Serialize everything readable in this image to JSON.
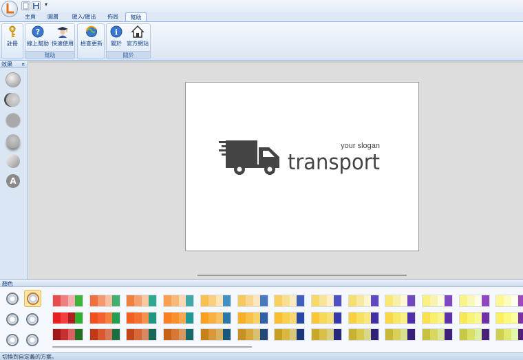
{
  "tabs": [
    "主頁",
    "圖層",
    "匯入/匯出",
    "佈局",
    "幫助"
  ],
  "active_tab": "幫助",
  "ribbon": {
    "groups": [
      {
        "label": "",
        "buttons": [
          {
            "label": "註冊",
            "icon": "key-icon"
          }
        ]
      },
      {
        "label": "幫助",
        "buttons": [
          {
            "label": "線上幫助",
            "icon": "help-icon"
          },
          {
            "label": "快速使用",
            "icon": "graduate-icon"
          }
        ]
      },
      {
        "label": "",
        "buttons": [
          {
            "label": "檢查更新",
            "icon": "update-globe-icon"
          }
        ]
      },
      {
        "label": "關於",
        "buttons": [
          {
            "label": "關於",
            "icon": "info-icon"
          },
          {
            "label": "官方網站",
            "icon": "home-icon"
          }
        ]
      }
    ]
  },
  "effects_panel": {
    "title": "效果",
    "items": [
      "effect-plain",
      "effect-shadow-left",
      "effect-flat",
      "effect-drop-shadow",
      "effect-gradient",
      "effect-text-a"
    ],
    "text_glyph": "A"
  },
  "logo": {
    "slogan": "your slogan",
    "name": "transport",
    "color": "#444444"
  },
  "colors_panel": {
    "title": "顏色",
    "palettes": [
      [
        [
          "#e84c4c",
          "#f08080",
          "#f4b0b0",
          "#3cb43c"
        ],
        [
          "#e82020",
          "#f04040",
          "#b02020",
          "#30b030"
        ],
        [
          "#a01818",
          "#c83030",
          "#d86060",
          "#207020"
        ]
      ],
      [
        [
          "#f07040",
          "#f49870",
          "#f8c0a0",
          "#40b070"
        ],
        [
          "#f05020",
          "#f46030",
          "#f48040",
          "#20a050"
        ],
        [
          "#c03818",
          "#d85830",
          "#d87858",
          "#187040"
        ]
      ],
      [
        [
          "#f08040",
          "#f4a070",
          "#f8c8a0",
          "#30a890"
        ],
        [
          "#f06020",
          "#f47030",
          "#f49050",
          "#209880"
        ],
        [
          "#c04818",
          "#d86838",
          "#d88860",
          "#186858"
        ]
      ],
      [
        [
          "#f8a050",
          "#f8b878",
          "#fcd8b0",
          "#40a8a8"
        ],
        [
          "#f88020",
          "#f89030",
          "#f8a850",
          "#209898"
        ],
        [
          "#c86018",
          "#d87838",
          "#d89860",
          "#186868"
        ]
      ],
      [
        [
          "#f8c050",
          "#f8d080",
          "#fce4b8",
          "#4090c0"
        ],
        [
          "#f8a020",
          "#f8b040",
          "#f8c060",
          "#2878a8"
        ],
        [
          "#c88018",
          "#d89838",
          "#d8b060",
          "#185878"
        ]
      ],
      [
        [
          "#f8c860",
          "#f8d890",
          "#fce8c0",
          "#4878c0"
        ],
        [
          "#f8b028",
          "#f8c048",
          "#f8d068",
          "#3060a8"
        ],
        [
          "#c89020",
          "#d8a840",
          "#d8c070",
          "#204878"
        ]
      ],
      [
        [
          "#f8d060",
          "#f8e090",
          "#fcecc0",
          "#4060c0"
        ],
        [
          "#f8c030",
          "#f8d050",
          "#f8d870",
          "#2848a8"
        ],
        [
          "#c8a020",
          "#d8b840",
          "#d8c878",
          "#183878"
        ]
      ],
      [
        [
          "#f8d868",
          "#f8e498",
          "#fcf0c8",
          "#5050c0"
        ],
        [
          "#f8c838",
          "#f8d858",
          "#f8e078",
          "#3838a8"
        ],
        [
          "#c8a828",
          "#d8c048",
          "#d8d080",
          "#282878"
        ]
      ],
      [
        [
          "#f8e070",
          "#f8e8a0",
          "#fcf4d0",
          "#6048c0"
        ],
        [
          "#f8d040",
          "#f8e060",
          "#f8e880",
          "#4030a8"
        ],
        [
          "#c8b030",
          "#d8c850",
          "#d8d888",
          "#302078"
        ]
      ],
      [
        [
          "#f8e878",
          "#f8f0a8",
          "#fcf8d8",
          "#7048c0"
        ],
        [
          "#f8d848",
          "#f8e868",
          "#f8f088",
          "#5030a8"
        ],
        [
          "#c8b838",
          "#d8d058",
          "#d8e090",
          "#382078"
        ]
      ],
      [
        [
          "#f8f080",
          "#f8f4b0",
          "#fcfce0",
          "#8048c0"
        ],
        [
          "#f8e050",
          "#f8f070",
          "#f8f490",
          "#6030a8"
        ],
        [
          "#c8c040",
          "#d8d860",
          "#d8e898",
          "#402078"
        ]
      ],
      [
        [
          "#f8f488",
          "#f8f8b8",
          "#fcfce8",
          "#9048c0"
        ],
        [
          "#f8e858",
          "#f8f478",
          "#f8f898",
          "#7030a8"
        ],
        [
          "#c8c848",
          "#d8e068",
          "#d8f0a0",
          "#482078"
        ]
      ],
      [
        [
          "#fcf890",
          "#fcfcc0",
          "#fefef0",
          "#a048c0"
        ],
        [
          "#fcf060",
          "#fcf880",
          "#fcfca0",
          "#8030a8"
        ],
        [
          "#d0d050",
          "#e0e870",
          "#e0f8a8",
          "#502078"
        ]
      ]
    ]
  },
  "status_text": "切換到自定義的方案。"
}
